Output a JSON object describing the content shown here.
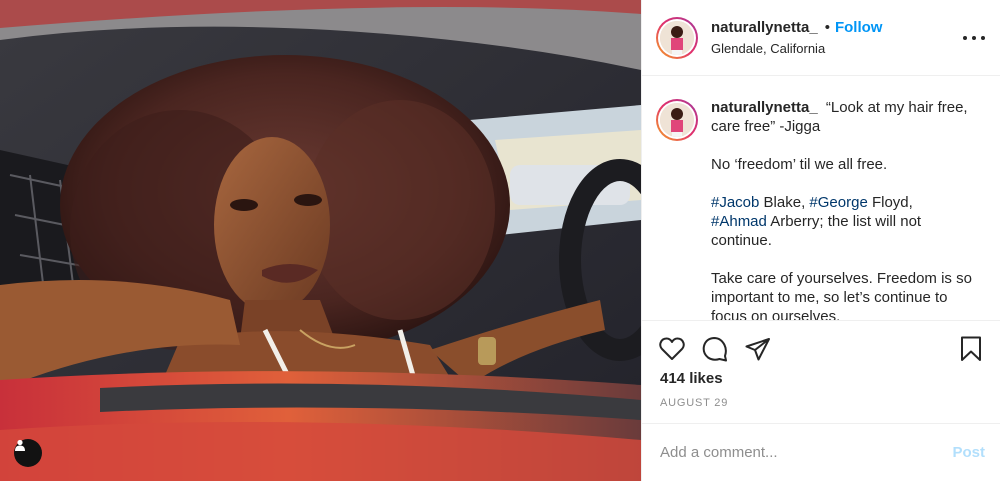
{
  "header": {
    "username": "naturallynetta_",
    "separator": "•",
    "follow_label": "Follow",
    "location": "Glendale, California"
  },
  "caption": {
    "username": "naturallynetta_",
    "paragraphs": [
      "“Look at my hair free, care free” -Jigga",
      "No ‘freedom’ til we all free.",
      "Take care of yourselves. Freedom is so important to me, so let’s continue to focus on ourselves."
    ],
    "hashtags": {
      "h1": "#Jacob",
      "t1": " Blake, ",
      "h2": "#George",
      "t2": " Floyd, ",
      "h3": "#Ahmad",
      "t3": " Arberry; the list will not continue."
    }
  },
  "actions": {
    "icons": [
      "heart-icon",
      "comment-icon",
      "share-icon",
      "bookmark-icon"
    ],
    "likes": "414 likes",
    "date": "AUGUST 29"
  },
  "comment": {
    "placeholder": "Add a comment...",
    "post_label": "Post"
  },
  "colors": {
    "accent": "#0095f6",
    "hashtag": "#00376b",
    "post_disabled": "#b2dffc",
    "secondary_text": "#8e8e8e"
  }
}
